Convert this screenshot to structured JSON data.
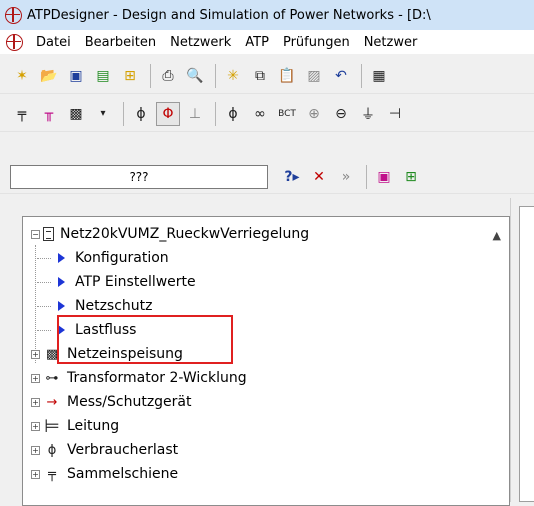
{
  "window": {
    "title": "ATPDesigner - Design and Simulation of Power Networks - [D:\\"
  },
  "menubar": {
    "items": [
      "Datei",
      "Bearbeiten",
      "Netzwerk",
      "ATP",
      "Prüfungen",
      "Netzwer"
    ]
  },
  "toolbar3": {
    "search_value": "???"
  },
  "tree": {
    "root_label": "Netz20kVUMZ_RueckwVerriegelung",
    "config_items": [
      "Konfiguration",
      "ATP Einstellwerte",
      "Netzschutz",
      "Lastfluss"
    ],
    "groups": [
      "Netzeinspeisung",
      "Transformator 2-Wicklung",
      "Mess/Schutzgerät",
      "Leitung",
      "Verbraucherlast",
      "Sammelschiene"
    ]
  },
  "colors": {
    "title_bar": "#cfe3f7",
    "highlight_box": "#e02020",
    "tree_arrow": "#1d35d6"
  }
}
